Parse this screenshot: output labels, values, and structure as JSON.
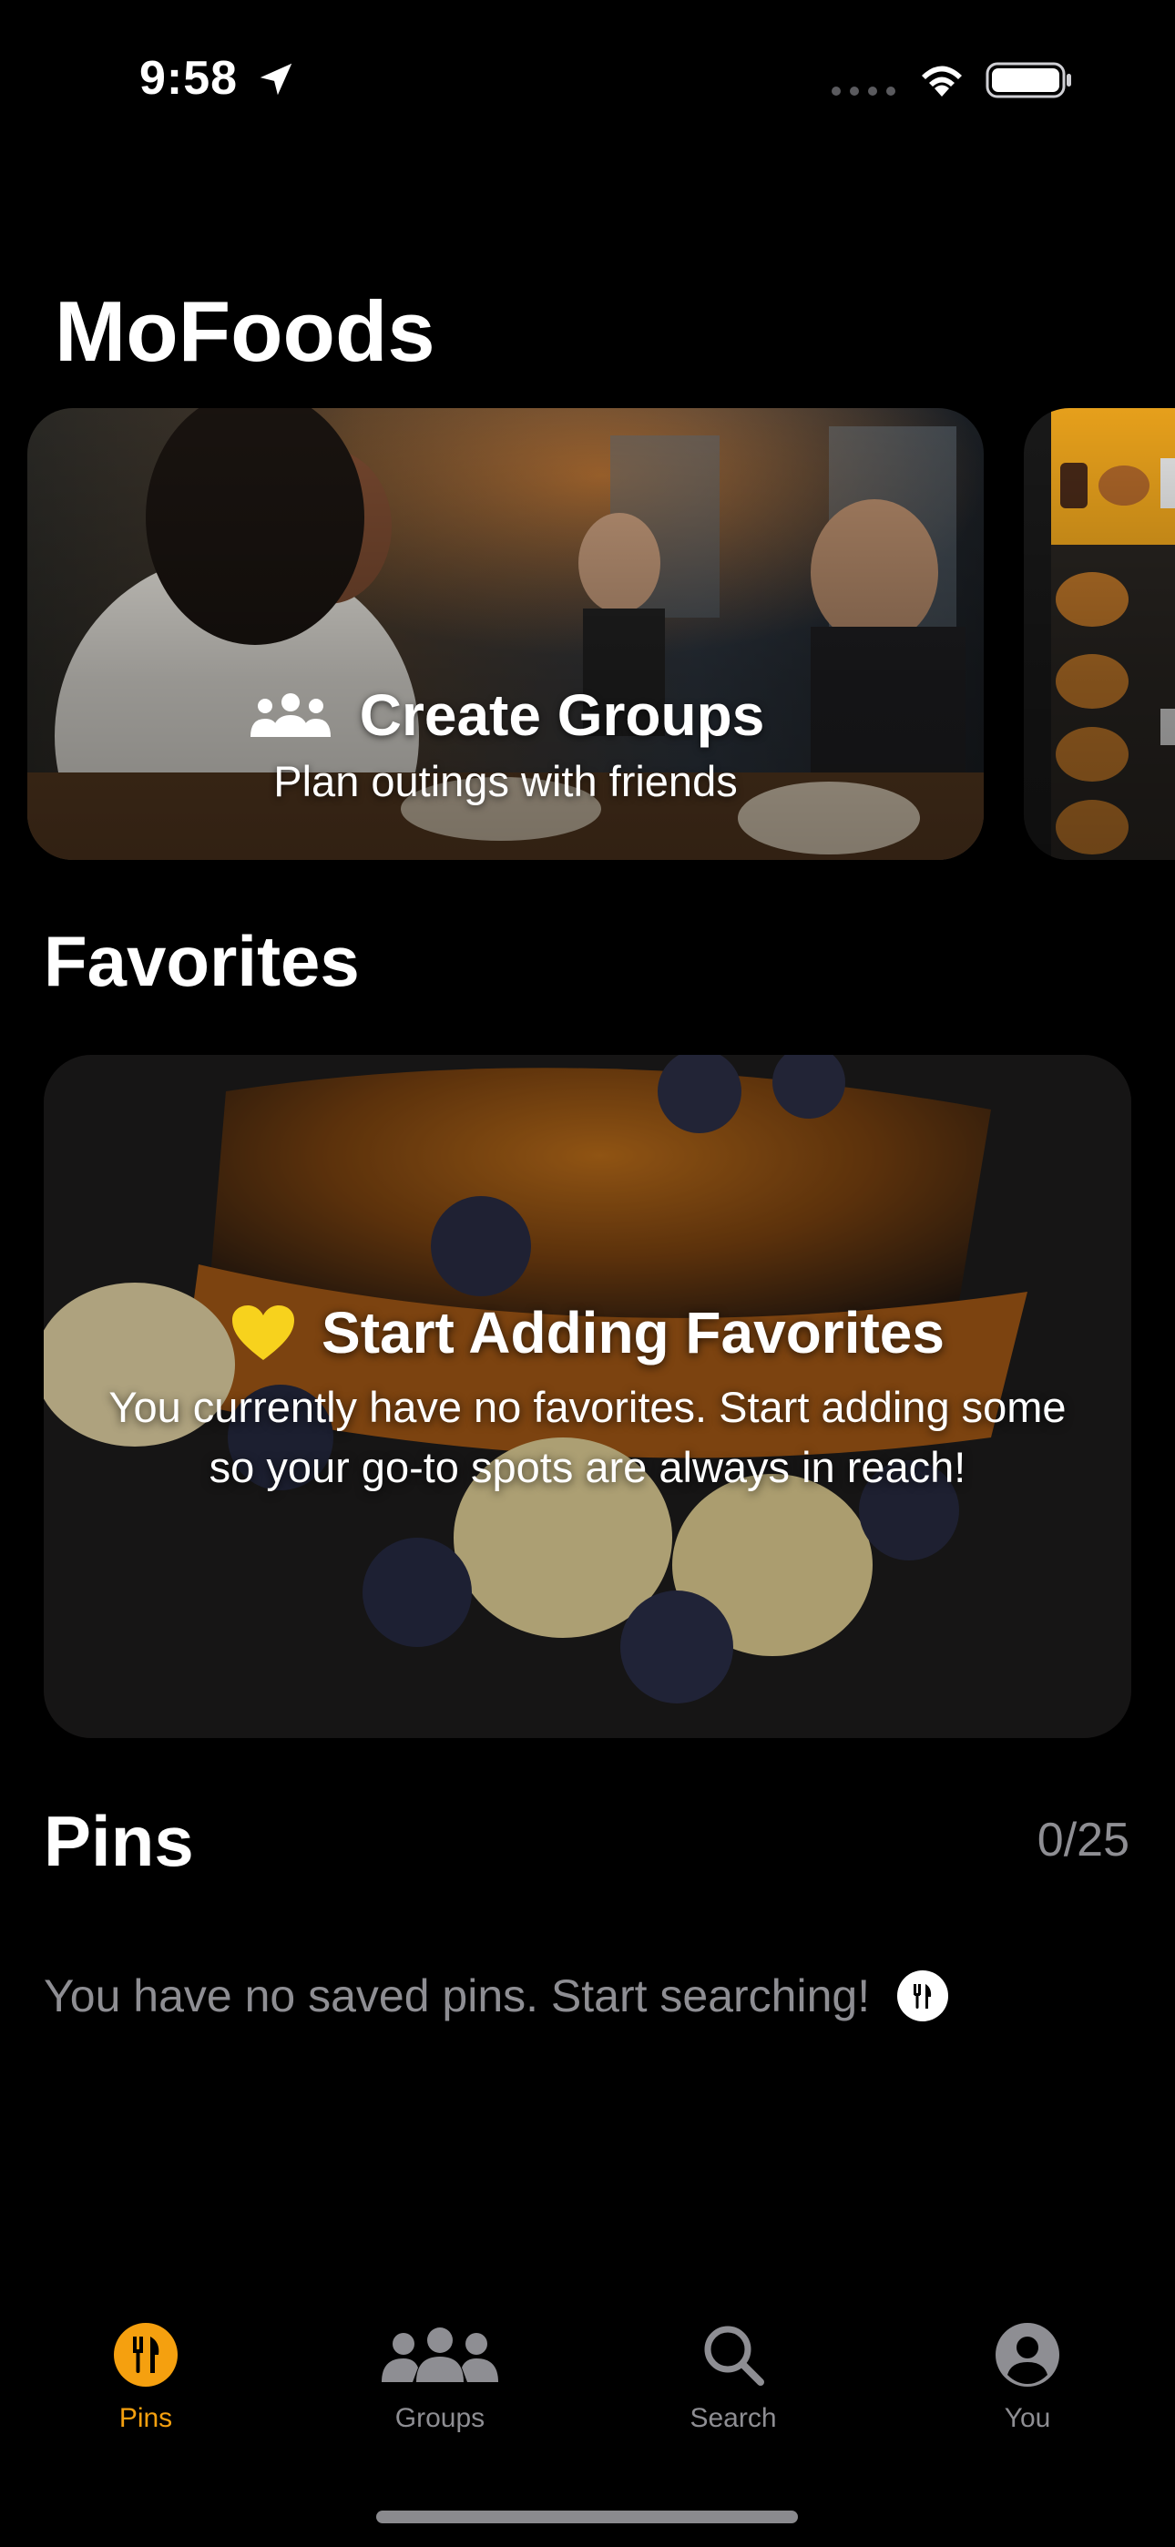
{
  "status_bar": {
    "time": "9:58",
    "icons": [
      "location-arrow-icon",
      "cellular-signal-icon",
      "wifi-icon",
      "battery-icon"
    ]
  },
  "app": {
    "title": "MoFoods",
    "accent_color": "#f5a00f"
  },
  "carousel": {
    "cards": [
      {
        "icon": "group-icon",
        "title": "Create Groups",
        "subtitle": "Plan outings with friends"
      },
      {
        "title": "",
        "subtitle": ""
      }
    ]
  },
  "favorites": {
    "section_title": "Favorites",
    "card": {
      "icon": "heart-icon",
      "icon_color": "#f7d21d",
      "title": "Start Adding Favorites",
      "description": "You currently have no favorites. Start adding some so your go-to spots are always in reach!"
    }
  },
  "pins": {
    "section_title": "Pins",
    "count": "0/25",
    "empty_message": "You have no saved pins. Start searching!",
    "empty_icon": "utensils-icon"
  },
  "tab_bar": {
    "active_color": "#f5a00f",
    "inactive_color": "#8e8e93",
    "tabs": [
      {
        "label": "Pins",
        "icon": "utensils-icon",
        "active": true
      },
      {
        "label": "Groups",
        "icon": "group-icon",
        "active": false
      },
      {
        "label": "Search",
        "icon": "search-icon",
        "active": false
      },
      {
        "label": "You",
        "icon": "profile-icon",
        "active": false
      }
    ]
  }
}
